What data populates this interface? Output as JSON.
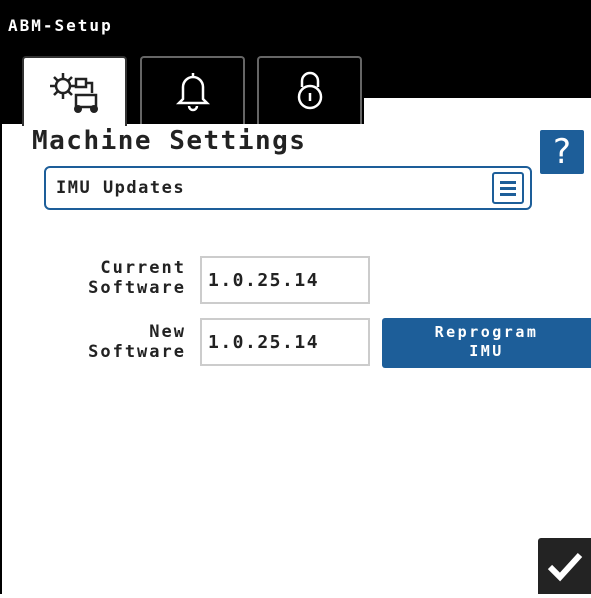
{
  "app": {
    "title": "ABM-Setup"
  },
  "tabs": [
    {
      "icon": "machine-settings-icon",
      "active": true
    },
    {
      "icon": "bell-icon",
      "active": false
    },
    {
      "icon": "lock-icon",
      "active": false
    }
  ],
  "page": {
    "title": "Machine Settings",
    "help_label": "?"
  },
  "dropdown": {
    "selected": "IMU Updates",
    "icon": "hamburger-menu-icon"
  },
  "software": {
    "current_label_line1": "Current",
    "current_label_line2": "Software",
    "current_value": "1.0.25.14",
    "new_label_line1": "New",
    "new_label_line2": "Software",
    "new_value": "1.0.25.14"
  },
  "actions": {
    "reprogram_line1": "Reprogram",
    "reprogram_line2": "IMU",
    "confirm_icon": "checkmark-icon"
  },
  "colors": {
    "accent": "#1d5e99",
    "bar": "#000000",
    "confirm": "#232323"
  }
}
